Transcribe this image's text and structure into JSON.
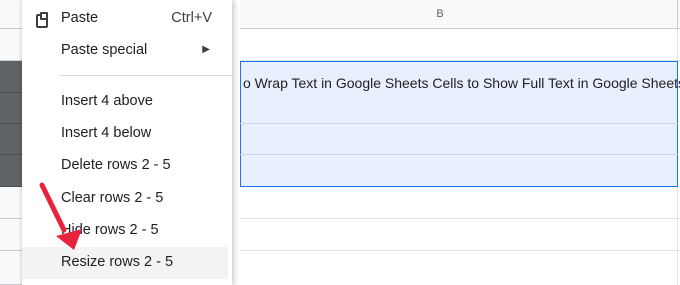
{
  "column_header": {
    "label": "B"
  },
  "cell": {
    "text": "o Wrap Text in Google Sheets Cells to Show Full Text in Google Sheets"
  },
  "menu": {
    "paste": {
      "label": "Paste",
      "shortcut": "Ctrl+V"
    },
    "paste_special": {
      "label": "Paste special"
    },
    "insert_above": {
      "label": "Insert 4 above"
    },
    "insert_below": {
      "label": "Insert 4 below"
    },
    "delete_rows": {
      "label": "Delete rows 2 - 5"
    },
    "clear_rows": {
      "label": "Clear rows 2 - 5"
    },
    "hide_rows": {
      "label": "Hide rows 2 - 5"
    },
    "resize_rows": {
      "label": "Resize rows 2 - 5"
    }
  },
  "colors": {
    "selection_fill": "#e8f0fe",
    "selection_border": "#1a73e8",
    "selected_row_header": "#5f6368",
    "annotation_arrow": "#e8243c"
  },
  "icons": {
    "paste": "clipboard-icon",
    "submenu": "submenu-arrow-icon",
    "annotation": "red-pointer-arrow"
  }
}
